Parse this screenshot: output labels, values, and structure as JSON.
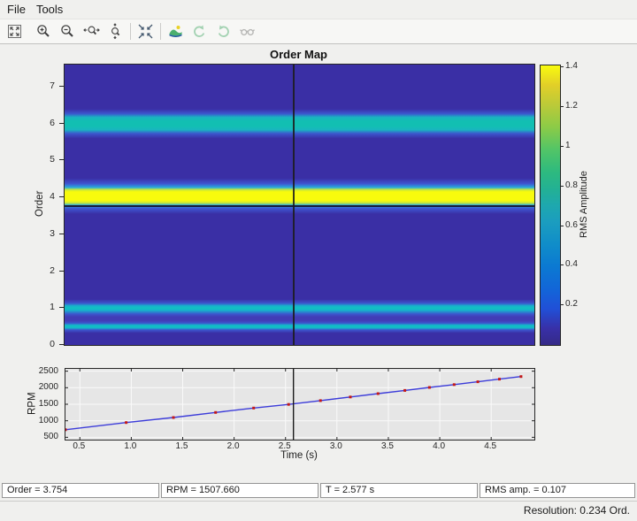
{
  "menu": {
    "items": [
      {
        "label": "File"
      },
      {
        "label": "Tools"
      }
    ]
  },
  "toolbar": {
    "buttons": [
      {
        "name": "fit-to-window",
        "enabled": true
      },
      {
        "name": "zoom-in",
        "enabled": true
      },
      {
        "name": "zoom-out",
        "enabled": true
      },
      {
        "name": "zoom-x",
        "enabled": true
      },
      {
        "name": "zoom-y",
        "enabled": true
      },
      {
        "name": "fit-data",
        "enabled": true
      },
      {
        "name": "colormap",
        "enabled": true
      },
      {
        "name": "rotate-left",
        "enabled": false
      },
      {
        "name": "rotate-right",
        "enabled": false
      },
      {
        "name": "3d-view",
        "enabled": false
      }
    ]
  },
  "order_map": {
    "title": "Order Map",
    "ylabel": "Order",
    "yticks": [
      0,
      1,
      2,
      3,
      4,
      5,
      6,
      7
    ],
    "order_range": [
      0,
      7.6
    ],
    "time_range": [
      0.36,
      4.92
    ],
    "background": "#3a2fa5",
    "cursor": {
      "time": 2.577,
      "order": 3.754
    },
    "gradient_stops": [
      [
        0.0,
        "#3a2fa5"
      ],
      [
        0.32,
        "#3a2fa5"
      ],
      [
        0.41,
        "#3c56ce"
      ],
      [
        0.46,
        "#17b2cb"
      ],
      [
        0.5,
        "#0fc1c2"
      ],
      [
        0.54,
        "#17b2cb"
      ],
      [
        0.59,
        "#3c56ce"
      ],
      [
        0.66,
        "#423cb6"
      ],
      [
        0.76,
        "#423cb6"
      ],
      [
        0.84,
        "#3c56ce"
      ],
      [
        0.94,
        "#17b2cb"
      ],
      [
        1.0,
        "#0fc1c2"
      ],
      [
        1.06,
        "#17b2cb"
      ],
      [
        1.13,
        "#3c56ce"
      ],
      [
        1.24,
        "#3a2fa5"
      ],
      [
        3.55,
        "#3a2fa5"
      ],
      [
        3.7,
        "#3e55d1"
      ],
      [
        3.79,
        "#27abdc"
      ],
      [
        3.85,
        "#c7e83c"
      ],
      [
        3.91,
        "#f8fb0d"
      ],
      [
        4.15,
        "#f8fb0d"
      ],
      [
        4.21,
        "#c7e83c"
      ],
      [
        4.27,
        "#27abdc"
      ],
      [
        4.37,
        "#3e55d1"
      ],
      [
        4.52,
        "#3a2fa5"
      ],
      [
        5.6,
        "#3a2fa5"
      ],
      [
        5.73,
        "#3c56ce"
      ],
      [
        5.83,
        "#19b5c0"
      ],
      [
        5.93,
        "#12bfb2"
      ],
      [
        6.07,
        "#12bfb2"
      ],
      [
        6.17,
        "#19b5c0"
      ],
      [
        6.27,
        "#3c56ce"
      ],
      [
        6.4,
        "#3a2fa5"
      ],
      [
        7.6,
        "#3a2fa5"
      ]
    ]
  },
  "colorbar": {
    "label": "RMS Amplitude",
    "tick_labels": [
      "0.2",
      "0.4",
      "0.6",
      "0.8",
      "1",
      "1.2",
      "1.4"
    ],
    "range": [
      0,
      1.41
    ],
    "stops": [
      [
        0.0,
        "#352a87"
      ],
      [
        0.06,
        "#3830a8"
      ],
      [
        0.13,
        "#2050d7"
      ],
      [
        0.2,
        "#1266d8"
      ],
      [
        0.28,
        "#0b79d2"
      ],
      [
        0.36,
        "#108dc9"
      ],
      [
        0.44,
        "#1b9dbf"
      ],
      [
        0.5,
        "#1ea8ae"
      ],
      [
        0.56,
        "#23b193"
      ],
      [
        0.62,
        "#2eba7e"
      ],
      [
        0.7,
        "#53c566"
      ],
      [
        0.78,
        "#8ccb47"
      ],
      [
        0.86,
        "#bcca38"
      ],
      [
        0.93,
        "#e2cf28"
      ],
      [
        1.0,
        "#f9fb0e"
      ]
    ]
  },
  "rpm_plot": {
    "ylabel": "RPM",
    "xlabel": "Time (s)",
    "ytick_labels": [
      "500",
      "1000",
      "1500",
      "2000",
      "2500"
    ],
    "xtick_labels": [
      "0.5",
      "1.0",
      "1.5",
      "2.0",
      "2.5",
      "3.0",
      "3.5",
      "4.0",
      "4.5"
    ],
    "y_range": [
      430,
      2570
    ],
    "bg": "#e6e6e6",
    "grid_color": "#fafafa",
    "line_color": "#3c3cd9",
    "marker_color": "#c41919",
    "cursor_color": "#1a1a1a"
  },
  "status": {
    "fields": [
      "Order = 3.754",
      "RPM = 1507.660",
      "T = 2.577 s",
      "RMS amp. = 0.107"
    ]
  },
  "footer": {
    "resolution": "Resolution: 0.234 Ord."
  },
  "chart_data": [
    {
      "type": "heatmap",
      "title": "Order Map",
      "xlabel": "Time (s)",
      "ylabel": "Order",
      "zlabel": "RMS Amplitude",
      "x_range": [
        0.36,
        4.92
      ],
      "y_range": [
        0,
        7.6
      ],
      "z_range": [
        0,
        1.41
      ],
      "bands": [
        {
          "order": 0.5,
          "rms_peak": 0.5
        },
        {
          "order": 1.0,
          "rms_peak": 0.5
        },
        {
          "order": 4.0,
          "rms_peak": 1.41
        },
        {
          "order": 6.0,
          "rms_peak": 0.55
        }
      ],
      "cursor": {
        "time": 2.577,
        "order": 3.754,
        "rpm": 1507.66,
        "rms": 0.107
      },
      "legend_position": "colorbar-right"
    },
    {
      "type": "line",
      "xlabel": "Time (s)",
      "ylabel": "RPM",
      "x": [
        0.36,
        0.95,
        1.41,
        1.82,
        2.19,
        2.53,
        2.84,
        3.13,
        3.4,
        3.66,
        3.9,
        4.14,
        4.37,
        4.58,
        4.79
      ],
      "y": [
        730,
        945,
        1100,
        1250,
        1385,
        1495,
        1610,
        1720,
        1820,
        1918,
        2008,
        2095,
        2180,
        2260,
        2338
      ],
      "xlim": [
        0.36,
        4.92
      ],
      "ylim": [
        430,
        2570
      ],
      "grid": true,
      "marker": "square"
    }
  ]
}
